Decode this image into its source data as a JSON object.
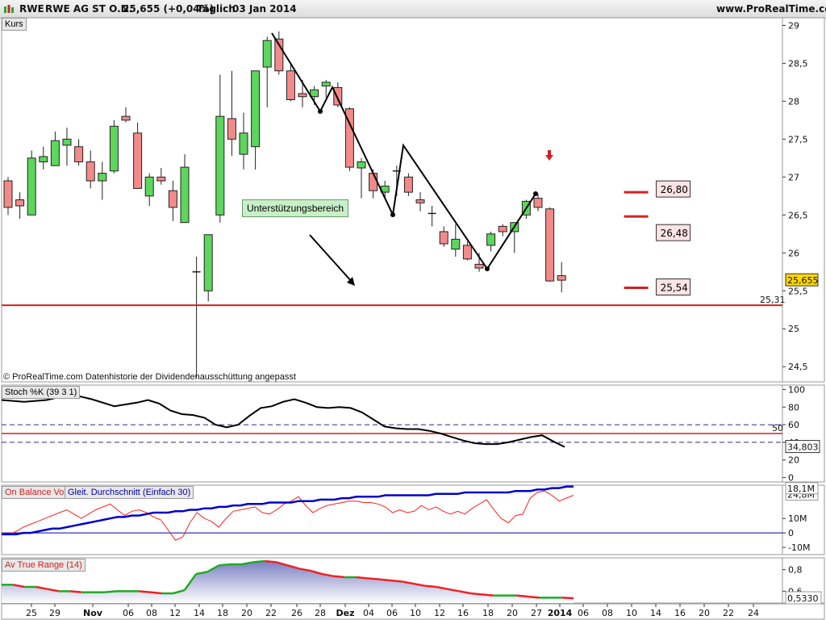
{
  "header": {
    "ticker": "RWE",
    "name": "RWE AG ST O.N.",
    "price_change": "25,655 (+0,04%)",
    "interval": "Täglich",
    "date": "03 Jan 2014",
    "site": "www.ProRealTime.com"
  },
  "colors": {
    "up": "#5cd65c",
    "down": "#f28a8a",
    "support": "#d42020",
    "stoch": "#000000",
    "obv": "#ff2020",
    "obv_ma": "#0000cc",
    "atr_fill": "#7a7fc2",
    "atr_up": "#22aa22",
    "atr_down": "#ee2222"
  },
  "chart_data": [
    {
      "type": "candlestick",
      "label": "Kurs",
      "ylim": [
        24.3,
        29.1
      ],
      "yticks": [
        24.5,
        25,
        25.5,
        26,
        26.5,
        27,
        27.5,
        28,
        28.5,
        29
      ],
      "ytick_labels": [
        "24,5",
        "25",
        "25,5",
        "26",
        "26,5",
        "27",
        "27,5",
        "28",
        "28,5",
        "29"
      ],
      "candles": [
        {
          "o": 26.95,
          "h": 27.0,
          "l": 26.5,
          "c": 26.6
        },
        {
          "o": 26.7,
          "h": 26.8,
          "l": 26.45,
          "c": 26.62
        },
        {
          "o": 26.5,
          "h": 27.35,
          "l": 26.5,
          "c": 27.25
        },
        {
          "o": 27.2,
          "h": 27.4,
          "l": 27.1,
          "c": 27.27
        },
        {
          "o": 27.15,
          "h": 27.6,
          "l": 27.15,
          "c": 27.48
        },
        {
          "o": 27.42,
          "h": 27.65,
          "l": 27.15,
          "c": 27.5
        },
        {
          "o": 27.4,
          "h": 27.5,
          "l": 27.15,
          "c": 27.2
        },
        {
          "o": 27.2,
          "h": 27.35,
          "l": 26.85,
          "c": 26.95
        },
        {
          "o": 26.95,
          "h": 27.2,
          "l": 26.7,
          "c": 27.05
        },
        {
          "o": 27.08,
          "h": 27.75,
          "l": 27.05,
          "c": 27.67
        },
        {
          "o": 27.8,
          "h": 27.92,
          "l": 27.72,
          "c": 27.75
        },
        {
          "o": 27.58,
          "h": 27.72,
          "l": 26.85,
          "c": 26.85
        },
        {
          "o": 26.75,
          "h": 27.05,
          "l": 26.62,
          "c": 27.0
        },
        {
          "o": 27.0,
          "h": 27.12,
          "l": 26.9,
          "c": 26.95
        },
        {
          "o": 26.82,
          "h": 26.95,
          "l": 26.42,
          "c": 26.6
        },
        {
          "o": 26.4,
          "h": 27.3,
          "l": 26.4,
          "c": 27.13
        },
        {
          "o": 25.75,
          "h": 25.95,
          "l": 24.35,
          "c": 25.75
        },
        {
          "o": 25.5,
          "h": 26.24,
          "l": 25.36,
          "c": 26.24
        },
        {
          "o": 26.5,
          "h": 28.35,
          "l": 26.4,
          "c": 27.8
        },
        {
          "o": 27.77,
          "h": 28.4,
          "l": 27.28,
          "c": 27.5
        },
        {
          "o": 27.3,
          "h": 27.85,
          "l": 27.1,
          "c": 27.58
        },
        {
          "o": 27.4,
          "h": 28.35,
          "l": 27.1,
          "c": 28.4
        },
        {
          "o": 28.45,
          "h": 28.85,
          "l": 27.92,
          "c": 28.8
        },
        {
          "o": 28.82,
          "h": 28.92,
          "l": 28.35,
          "c": 28.4
        },
        {
          "o": 28.4,
          "h": 28.48,
          "l": 28.0,
          "c": 28.02
        },
        {
          "o": 28.1,
          "h": 28.28,
          "l": 27.92,
          "c": 28.06
        },
        {
          "o": 28.06,
          "h": 28.2,
          "l": 27.95,
          "c": 28.15
        },
        {
          "o": 28.2,
          "h": 28.28,
          "l": 28.05,
          "c": 28.25
        },
        {
          "o": 28.18,
          "h": 28.25,
          "l": 27.92,
          "c": 27.95
        },
        {
          "o": 27.9,
          "h": 27.92,
          "l": 27.08,
          "c": 27.13
        },
        {
          "o": 27.12,
          "h": 27.25,
          "l": 26.72,
          "c": 27.2
        },
        {
          "o": 27.05,
          "h": 27.1,
          "l": 26.72,
          "c": 26.82
        },
        {
          "o": 26.8,
          "h": 26.95,
          "l": 26.72,
          "c": 26.88
        },
        {
          "o": 27.08,
          "h": 27.15,
          "l": 26.75,
          "c": 27.08
        },
        {
          "o": 27.0,
          "h": 27.05,
          "l": 26.75,
          "c": 26.8
        },
        {
          "o": 26.7,
          "h": 26.8,
          "l": 26.55,
          "c": 26.66
        },
        {
          "o": 26.52,
          "h": 26.62,
          "l": 26.35,
          "c": 26.52
        },
        {
          "o": 26.28,
          "h": 26.35,
          "l": 26.08,
          "c": 26.12
        },
        {
          "o": 26.05,
          "h": 26.38,
          "l": 25.95,
          "c": 26.18
        },
        {
          "o": 26.1,
          "h": 26.15,
          "l": 25.9,
          "c": 25.92
        },
        {
          "o": 25.85,
          "h": 26.0,
          "l": 25.75,
          "c": 25.8
        },
        {
          "o": 26.1,
          "h": 26.28,
          "l": 26.02,
          "c": 26.25
        },
        {
          "o": 26.35,
          "h": 26.38,
          "l": 26.22,
          "c": 26.28
        },
        {
          "o": 26.28,
          "h": 26.4,
          "l": 26.0,
          "c": 26.4
        },
        {
          "o": 26.5,
          "h": 26.7,
          "l": 26.45,
          "c": 26.68
        },
        {
          "o": 26.72,
          "h": 26.78,
          "l": 26.55,
          "c": 26.6
        },
        {
          "o": 26.58,
          "h": 26.6,
          "l": 25.62,
          "c": 25.63
        },
        {
          "o": 25.7,
          "h": 25.88,
          "l": 25.48,
          "c": 25.64
        }
      ],
      "support_level": 25.31,
      "support_label": "25,31",
      "target_levels": [
        {
          "value": 26.8,
          "label": "26,80"
        },
        {
          "value": 26.48,
          "label": "26,48"
        },
        {
          "value": 25.54,
          "label": "25,54"
        }
      ],
      "last_price_label": "25,655",
      "annotations": {
        "support_zone": "Unterstützungsbereich",
        "copyright": "© ProRealTime.com  Datenhistorie der Dividendenausschüttung angepasst"
      }
    },
    {
      "type": "line",
      "label": "Stoch %K (39 3 1)",
      "ylim": [
        -5,
        105
      ],
      "yticks": [
        0,
        20,
        40,
        60,
        80,
        100
      ],
      "ytick_labels": [
        "0",
        "20",
        "40",
        "60",
        "80",
        "100"
      ],
      "values": [
        88,
        87,
        86,
        87,
        88,
        91,
        93,
        92,
        89,
        85,
        81,
        83,
        85,
        88,
        84,
        76,
        72,
        71,
        68,
        60,
        57,
        60,
        70,
        79,
        81,
        86,
        89,
        85,
        80,
        79,
        80,
        79,
        74,
        66,
        58,
        56,
        55,
        55,
        53,
        50,
        46,
        42,
        39,
        38,
        38,
        40,
        43,
        46,
        48,
        41,
        34.8
      ],
      "level_lines": [
        {
          "value": 60,
          "label": ""
        },
        {
          "value": 50,
          "label": "50"
        },
        {
          "value": 40,
          "label": ""
        }
      ],
      "last_value_label": "34,803"
    },
    {
      "type": "line",
      "label": "On Balance Vol",
      "label2": "Gleit. Durchschnitt (Einfach 30)",
      "ylim": [
        -15,
        33
      ],
      "yticks": [
        -10,
        0,
        10
      ],
      "ytick_labels": [
        "-10M",
        "0",
        "10M"
      ],
      "series": [
        {
          "name": "On Balance Vol",
          "values": [
            0,
            -1,
            1,
            4,
            6,
            8,
            10,
            12,
            14,
            16,
            13,
            10,
            13,
            16,
            18,
            20,
            16,
            12,
            15,
            16,
            14,
            11,
            9,
            2,
            -5,
            -3,
            7,
            14,
            10,
            8,
            4,
            10,
            15,
            16,
            17,
            18,
            14,
            13,
            16,
            20,
            22,
            25,
            19,
            14,
            17,
            19,
            20,
            21,
            22,
            22,
            21,
            21,
            20,
            18,
            14,
            16,
            14,
            15,
            19,
            16,
            18,
            15,
            13,
            15,
            13,
            17,
            20,
            23,
            16,
            10,
            7,
            12,
            13,
            24,
            28,
            29,
            26,
            22,
            24,
            26
          ]
        },
        {
          "name": "Gleit. Durchschnitt (Einfach 30)",
          "values": [
            -1,
            -1,
            -1,
            0,
            0,
            1,
            2,
            3,
            3,
            4,
            5,
            6,
            7,
            8,
            9,
            10,
            11,
            11,
            12,
            12,
            13,
            14,
            14,
            14,
            15,
            15,
            16,
            16,
            17,
            17,
            18,
            18,
            19,
            19,
            20,
            20,
            20,
            21,
            21,
            21,
            21,
            22,
            22,
            22,
            23,
            23,
            23,
            24,
            24,
            25,
            25,
            25,
            25,
            26,
            26,
            26,
            26,
            26,
            26,
            26,
            27,
            27,
            27,
            27,
            28,
            28,
            28,
            28,
            28,
            28,
            28,
            29,
            29,
            29,
            30,
            30,
            31,
            31,
            32,
            32
          ]
        }
      ],
      "last_value_labels": [
        "24,8M",
        "18,1M"
      ]
    },
    {
      "type": "area",
      "label": "Av True Range (14)",
      "ylim": [
        0.49,
        0.91
      ],
      "yticks": [
        0.6,
        0.8
      ],
      "ytick_labels": [
        "0,6",
        "0,8"
      ],
      "values": [
        0.66,
        0.66,
        0.64,
        0.64,
        0.62,
        0.6,
        0.6,
        0.59,
        0.59,
        0.59,
        0.6,
        0.6,
        0.6,
        0.59,
        0.58,
        0.58,
        0.61,
        0.76,
        0.78,
        0.84,
        0.85,
        0.85,
        0.87,
        0.88,
        0.87,
        0.84,
        0.81,
        0.79,
        0.76,
        0.74,
        0.73,
        0.73,
        0.72,
        0.71,
        0.7,
        0.69,
        0.67,
        0.65,
        0.64,
        0.62,
        0.6,
        0.58,
        0.57,
        0.56,
        0.56,
        0.56,
        0.55,
        0.54,
        0.54,
        0.54,
        0.535
      ],
      "last_value_label": "0,5330"
    }
  ],
  "x_axis": {
    "labels": [
      "25",
      "29",
      "Nov",
      "06",
      "08",
      "12",
      "14",
      "18",
      "20",
      "22",
      "26",
      "28",
      "Dez",
      "04",
      "06",
      "10",
      "12",
      "16",
      "18",
      "20",
      "27",
      "2014",
      "06",
      "08",
      "10",
      "14",
      "16",
      "20",
      "22",
      "24"
    ],
    "bold": [
      "Nov",
      "Dez",
      "2014"
    ]
  }
}
